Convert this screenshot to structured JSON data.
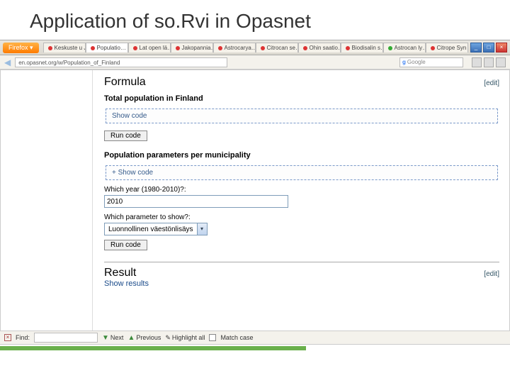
{
  "slide": {
    "title": "Application of so.Rvi in Opasnet"
  },
  "chrome": {
    "firefox_btn": "Firefox ▾",
    "tabs": [
      {
        "label": "Keskuste u J…",
        "dot": "red"
      },
      {
        "label": "Populatio…",
        "dot": "red",
        "active": true
      },
      {
        "label": "Lat open lä…",
        "dot": "red"
      },
      {
        "label": "Jakopannia…",
        "dot": "red"
      },
      {
        "label": "Astrocarya…",
        "dot": "red"
      },
      {
        "label": "Citrocan se…",
        "dot": "red"
      },
      {
        "label": "Ohin saatio…",
        "dot": "red"
      },
      {
        "label": "Biodisalin s…",
        "dot": "red"
      },
      {
        "label": "Astrocan ly…",
        "dot": "green"
      },
      {
        "label": "Citrope Syn",
        "dot": "red"
      }
    ],
    "url": "en.opasnet.org/w/Population_of_Finland",
    "search_placeholder": "Google"
  },
  "page": {
    "formula_heading": "Formula",
    "edit_link": "[edit]",
    "sub1": "Total population in Finland",
    "showcode": "Show code",
    "run_code": "Run code",
    "sub2": "Population parameters per municipality",
    "showcode2": "+  Show code",
    "year_label": "Which year (1980-2010)?:",
    "year_value": "2010",
    "param_label": "Which parameter to show?:",
    "param_value": "Luonnollinen väestönlisäys",
    "result_heading": "Result",
    "show_results": "Show results"
  },
  "findbar": {
    "find_label": "Find:",
    "next": "Next",
    "previous": "Previous",
    "highlight": "Highlight all",
    "match": "Match case"
  }
}
